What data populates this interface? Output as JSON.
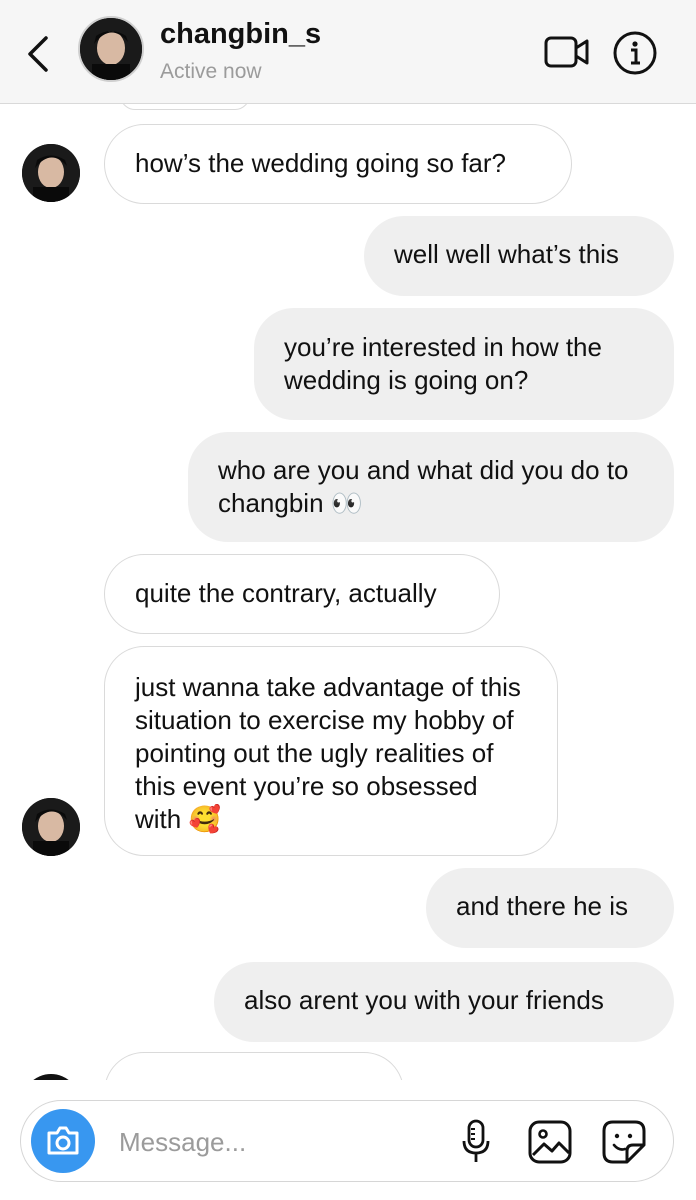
{
  "header": {
    "username": "changbin_s",
    "status": "Active now"
  },
  "messages": [
    {
      "from": "them",
      "text": "how’s the wedding going so far?"
    },
    {
      "from": "me",
      "text": "well well what’s this"
    },
    {
      "from": "me",
      "text": "you’re interested in how the wedding is going on?"
    },
    {
      "from": "me",
      "text": "who are you and what did you do to changbin 👀"
    },
    {
      "from": "them",
      "text": "quite the contrary, actually"
    },
    {
      "from": "them",
      "text": "just wanna take advantage of this situation to exercise my hobby of pointing out the ugly realities of this event you’re so obsessed with 🥰"
    },
    {
      "from": "me",
      "text": "and there he is"
    },
    {
      "from": "me",
      "text": "also arent you with your friends"
    }
  ],
  "composer": {
    "placeholder": "Message..."
  },
  "icons": {
    "back": "chevron-left-icon",
    "video": "video-call-icon",
    "info": "info-icon",
    "camera": "camera-icon",
    "mic": "microphone-icon",
    "gallery": "gallery-icon",
    "sticker": "sticker-icon"
  },
  "colors": {
    "accent": "#3897f0",
    "outgoing_bubble": "#efefef",
    "incoming_border": "#dadada"
  }
}
